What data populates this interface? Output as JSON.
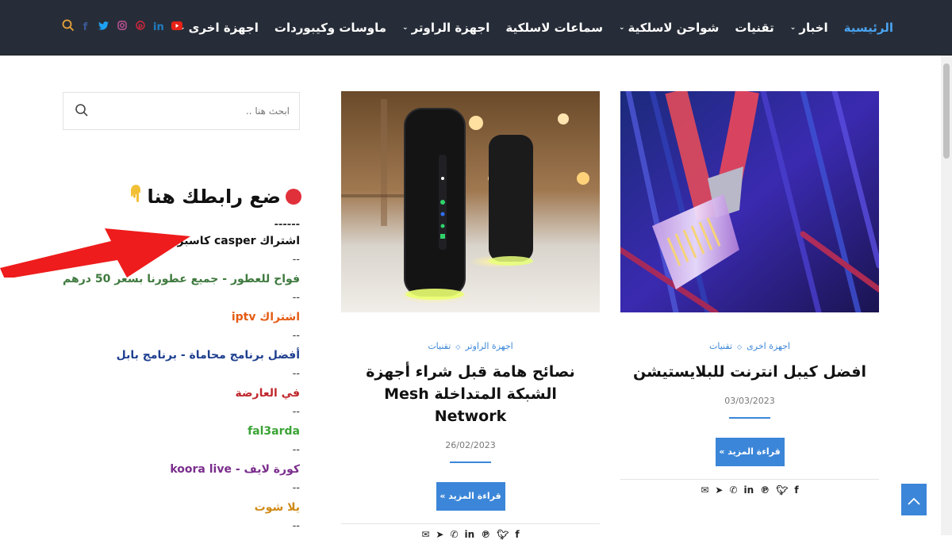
{
  "nav": {
    "items": [
      {
        "label": "الرئيسية",
        "active": true,
        "dropdown": false
      },
      {
        "label": "اخبار",
        "active": false,
        "dropdown": true
      },
      {
        "label": "تقنيات",
        "active": false,
        "dropdown": false
      },
      {
        "label": "شواحن لاسلكية",
        "active": false,
        "dropdown": true
      },
      {
        "label": "سماعات لاسلكية",
        "active": false,
        "dropdown": false
      },
      {
        "label": "اجهزة الراوتر",
        "active": false,
        "dropdown": true
      },
      {
        "label": "ماوسات وكيبوردات",
        "active": false,
        "dropdown": false
      },
      {
        "label": "اجهزة اخرى",
        "active": false,
        "dropdown": true
      }
    ],
    "social": [
      "search-icon",
      "facebook-icon",
      "twitter-icon",
      "instagram-icon",
      "pinterest-icon",
      "linkedin-icon",
      "youtube-icon"
    ]
  },
  "sidebar": {
    "search_placeholder": "ابحث هنا ..",
    "widget_title": "ضع رابطك هنا",
    "dashes": "------",
    "separator": "--",
    "links": [
      {
        "label": "اشتراك casper كاسبر",
        "color": "#111111"
      },
      {
        "label": "فواح للعطور - جميع عطورنا بسعر 50 درهم",
        "color": "#3f7a3f"
      },
      {
        "label": "اشتراك iptv",
        "color": "#e55b13"
      },
      {
        "label": "أفضل برنامج محاماة - برنامج بابل",
        "color": "#1f3f8f"
      },
      {
        "label": "في العارضة",
        "color": "#c0282d"
      },
      {
        "label": "fal3arda",
        "color": "#3aa335"
      },
      {
        "label": "كورة لايف - koora live",
        "color": "#7a2d8c"
      },
      {
        "label": "يلا شوت",
        "color": "#d08a18"
      }
    ]
  },
  "posts": [
    {
      "categories": [
        "اجهزة اخرى",
        "تقنيات"
      ],
      "title": "افضل كيبل انترنت للبلايستيشن",
      "date": "03/03/2023",
      "read_more": "قراءة المزيد »"
    },
    {
      "categories": [
        "اجهزة الراوتر",
        "تقنيات"
      ],
      "title": "نصائح هامة قبل شراء أجهزة الشبكة المتداخلة Mesh Network",
      "date": "26/02/2023",
      "read_more": "قراءة المزيد »"
    }
  ],
  "share_icons": [
    "facebook-icon",
    "twitter-icon",
    "pinterest-icon",
    "linkedin-icon",
    "whatsapp-icon",
    "telegram-icon",
    "email-icon"
  ],
  "colors": {
    "nav_bg": "#272d38",
    "accent": "#3b86d8",
    "active_menu": "#4aa3f0"
  }
}
